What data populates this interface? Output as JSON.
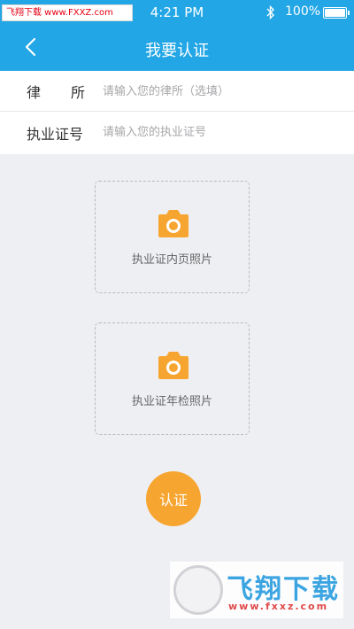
{
  "status_bar": {
    "watermark_text": "飞翔下载 www.FXXZ.com",
    "time": "4:21 PM",
    "battery": "100%",
    "icons": [
      "bluetooth-icon",
      "battery-icon"
    ]
  },
  "nav": {
    "title": "我要认证",
    "back_icon": "chevron-left-icon"
  },
  "form": {
    "firm_label_chars": [
      "律",
      "所"
    ],
    "firm_placeholder": "请输入您的律所（选填）",
    "license_label": "执业证号",
    "license_placeholder": "请输入您的执业证号"
  },
  "uploads": {
    "inner_page_label": "执业证内页照片",
    "annual_check_label": "执业证年检照片",
    "icon": "camera-icon"
  },
  "submit": {
    "label": "认证"
  },
  "watermark": {
    "brand": "飞翔下载",
    "url": "www.fxxz.com"
  },
  "colors": {
    "header": "#22a6e6",
    "accent": "#f7a531",
    "background": "#eeeff3"
  }
}
